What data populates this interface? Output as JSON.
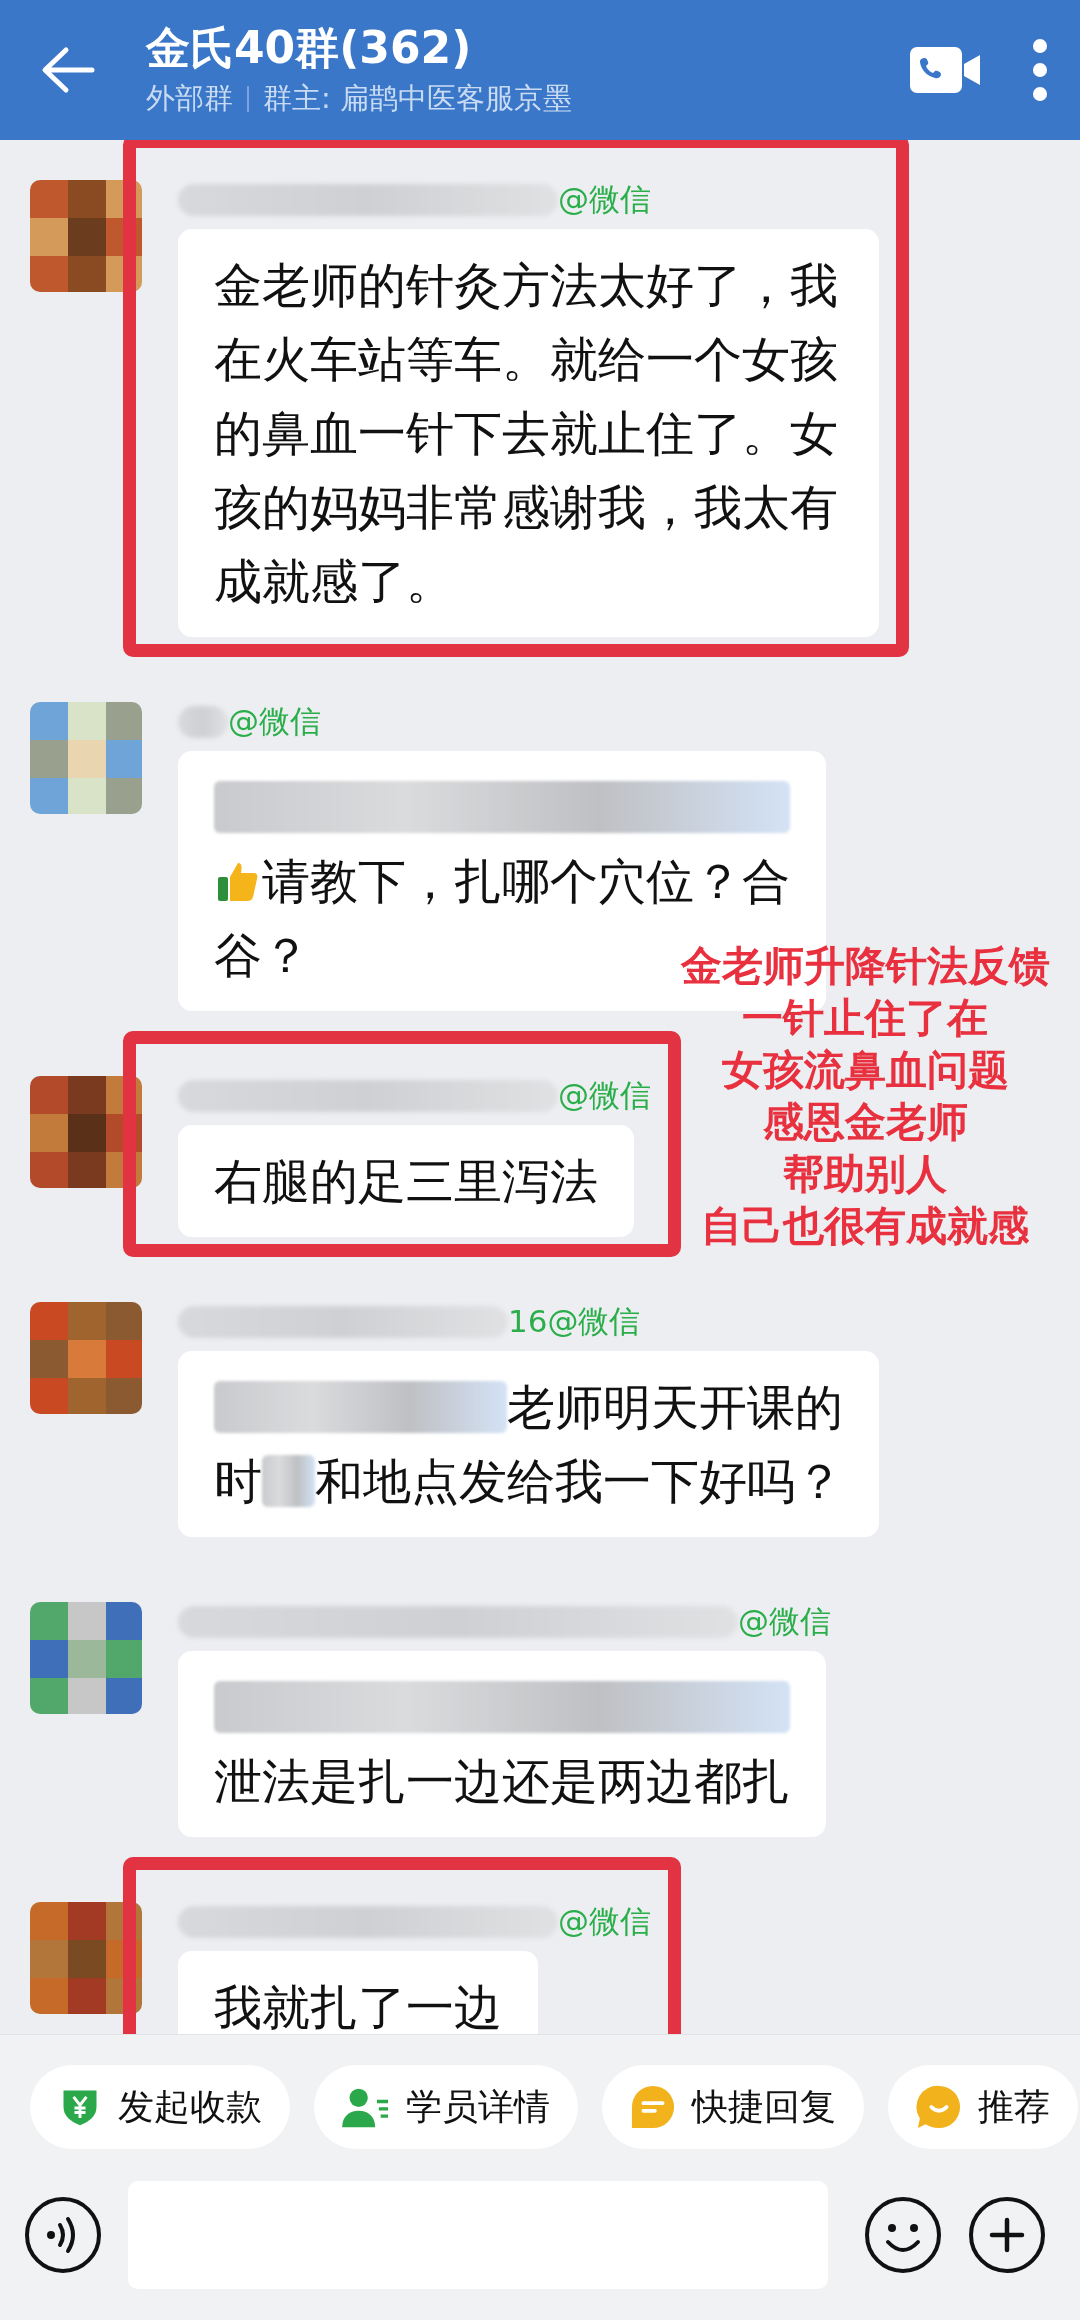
{
  "header": {
    "title": "金氏40群(362)",
    "tag": "外部群",
    "owner": "群主: 扁鹊中医客服京墨"
  },
  "messages": [
    {
      "name": [
        {
          "kind": "blur"
        },
        {
          "kind": "text",
          "text": "@微信"
        }
      ],
      "highlighted": true,
      "text": "金老师的针灸方法太好了，我在火车站等车。就给一个女孩的鼻血一针下去就止住了。女孩的妈妈非常感谢我，我太有成就感了。"
    },
    {
      "name": [
        {
          "kind": "blur"
        },
        {
          "kind": "text",
          "text": "@微信"
        }
      ],
      "highlighted": false,
      "lines": [
        [
          {
            "kind": "blur"
          }
        ],
        [
          {
            "kind": "emoji"
          },
          {
            "kind": "text",
            "text": "请教下，扎哪个穴位？合"
          }
        ],
        [
          {
            "kind": "text",
            "text": "谷？"
          }
        ]
      ]
    },
    {
      "name": [
        {
          "kind": "blur"
        },
        {
          "kind": "text",
          "text": "@微信"
        }
      ],
      "highlighted": true,
      "text": "右腿的足三里泻法"
    },
    {
      "name": [
        {
          "kind": "blur"
        },
        {
          "kind": "text",
          "text": "16@微信"
        }
      ],
      "highlighted": false,
      "lines": [
        [
          {
            "kind": "blur"
          },
          {
            "kind": "text",
            "text": "老师明天开课的"
          }
        ],
        [
          {
            "kind": "text",
            "text": "时"
          },
          {
            "kind": "blur"
          },
          {
            "kind": "text",
            "text": "和地点发给我一下好吗？"
          }
        ]
      ]
    },
    {
      "name": [
        {
          "kind": "blur"
        },
        {
          "kind": "text",
          "text": "@微信"
        }
      ],
      "highlighted": false,
      "lines": [
        [
          {
            "kind": "blur"
          }
        ],
        [
          {
            "kind": "text",
            "text": "泄法是扎一边还是两边都扎"
          }
        ]
      ]
    },
    {
      "name": [
        {
          "kind": "blur"
        },
        {
          "kind": "text",
          "text": "@微信"
        }
      ],
      "highlighted": true,
      "text": "我就扎了一边"
    }
  ],
  "annotation": [
    "金老师升降针法反馈",
    "一针止住了在",
    "女孩流鼻血问题",
    "感恩金老师",
    "帮助别人",
    "自己也很有成就感"
  ],
  "quick_actions": [
    {
      "kind": "payment",
      "label": "发起收款"
    },
    {
      "kind": "student",
      "label": "学员详情"
    },
    {
      "kind": "reply",
      "label": "快捷回复"
    },
    {
      "kind": "recommend",
      "label": "推荐"
    }
  ]
}
